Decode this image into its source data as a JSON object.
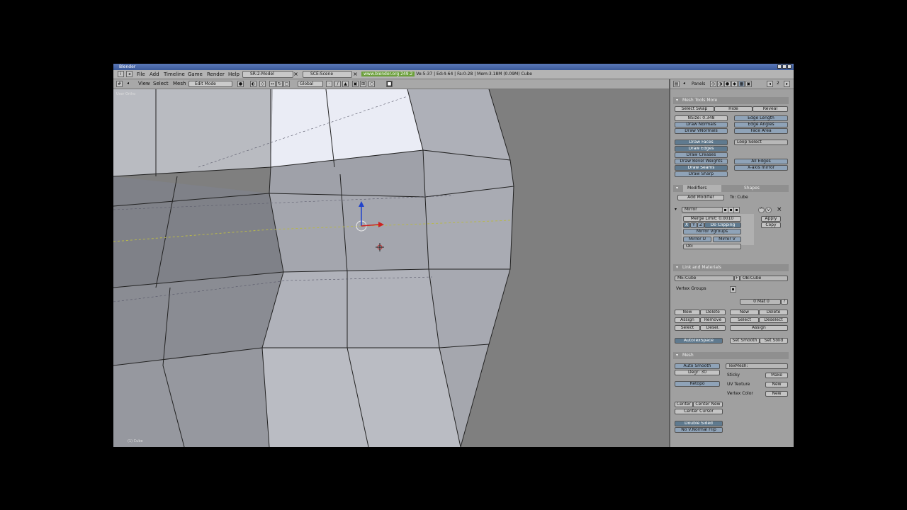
{
  "window": {
    "title": "Blender"
  },
  "menubar": {
    "items": [
      "File",
      "Add",
      "Timeline",
      "Game",
      "Render",
      "Help"
    ],
    "screen": "SR:2-Model",
    "scene": "SCE:Scene",
    "url": "www.blender.org 249.2",
    "stats": "Ve:5-37 | Ed:4-64 | Fa:0-28 | Mem:3.18M (0.09M) Cube"
  },
  "view3d_header": {
    "menus": [
      "View",
      "Select",
      "Mesh"
    ],
    "mode": "Edit Mode",
    "orientation": "Global"
  },
  "viewport": {
    "label_top": "User Ortho",
    "label_bottom": "(1) Cube"
  },
  "buttons_header": {
    "label": "Panels",
    "frame": "2"
  },
  "mesh_tools_more": {
    "title": "Mesh Tools More",
    "select_swap": "Select Swap",
    "hide": "Hide",
    "reveal": "Reveal",
    "nsize": "NSize: 0.348",
    "draw_normals": "Draw Normals",
    "draw_vnormals": "Draw VNormals",
    "edge_length": "Edge Length",
    "edge_angles": "Edge Angles",
    "face_area": "Face Area",
    "draw_faces": "Draw Faces",
    "draw_edges": "Draw Edges",
    "draw_creases": "Draw Creases",
    "draw_bevel": "Draw Bevel Weights",
    "draw_seams": "Draw Seams",
    "draw_sharp": "Draw Sharp",
    "loop_select": "Loop Select",
    "all_edges": "All Edges",
    "xaxis_mirror": "X-axis mirror"
  },
  "modifiers": {
    "tab_modifiers": "Modifiers",
    "tab_shapes": "Shapes",
    "add_modifier": "Add Modifier",
    "to": "To: Cube",
    "mirror_name": "Mirror",
    "merge_limit": "Merge Limit: 0.0010",
    "x": "X",
    "y": "Y",
    "z": "Z",
    "do_clipping": "Do Clipping",
    "mirror_vgroups": "Mirror Vgroups",
    "mirror_u": "Mirror U",
    "mirror_v": "Mirror V",
    "ob": "Ob:",
    "apply": "Apply",
    "copy": "Copy"
  },
  "link_materials": {
    "title": "Link and Materials",
    "me": "ME:Cube",
    "f": "F",
    "ob": "OB:Cube",
    "vertex_groups": "Vertex Groups",
    "mat": "0 Mat 0",
    "q": "?",
    "new_l": "New",
    "delete_l": "Delete",
    "assign_l": "Assign",
    "remove_l": "Remove",
    "select_l": "Select",
    "desel_l": "Desel.",
    "new_r": "New",
    "delete_r": "Delete",
    "select_r": "Select",
    "deselect_r": "Deselect",
    "assign_r": "Assign",
    "autotexspace": "AutoTexSpace",
    "set_smooth": "Set Smooth",
    "set_solid": "Set Solid"
  },
  "mesh": {
    "title": "Mesh",
    "auto_smooth": "Auto Smooth",
    "degr": "Degr: 30",
    "retopo": "Retopo",
    "texmesh": "TexMesh:",
    "sticky": "Sticky",
    "make": "Make",
    "uv_texture": "UV Texture",
    "new1": "New",
    "vertex_color": "Vertex Color",
    "new2": "New",
    "center": "Center",
    "center_new": "Center New",
    "center_cursor": "Center Cursor",
    "double_sided": "Double Sided",
    "no_vnormal_flip": "No V.Normal Flip"
  }
}
